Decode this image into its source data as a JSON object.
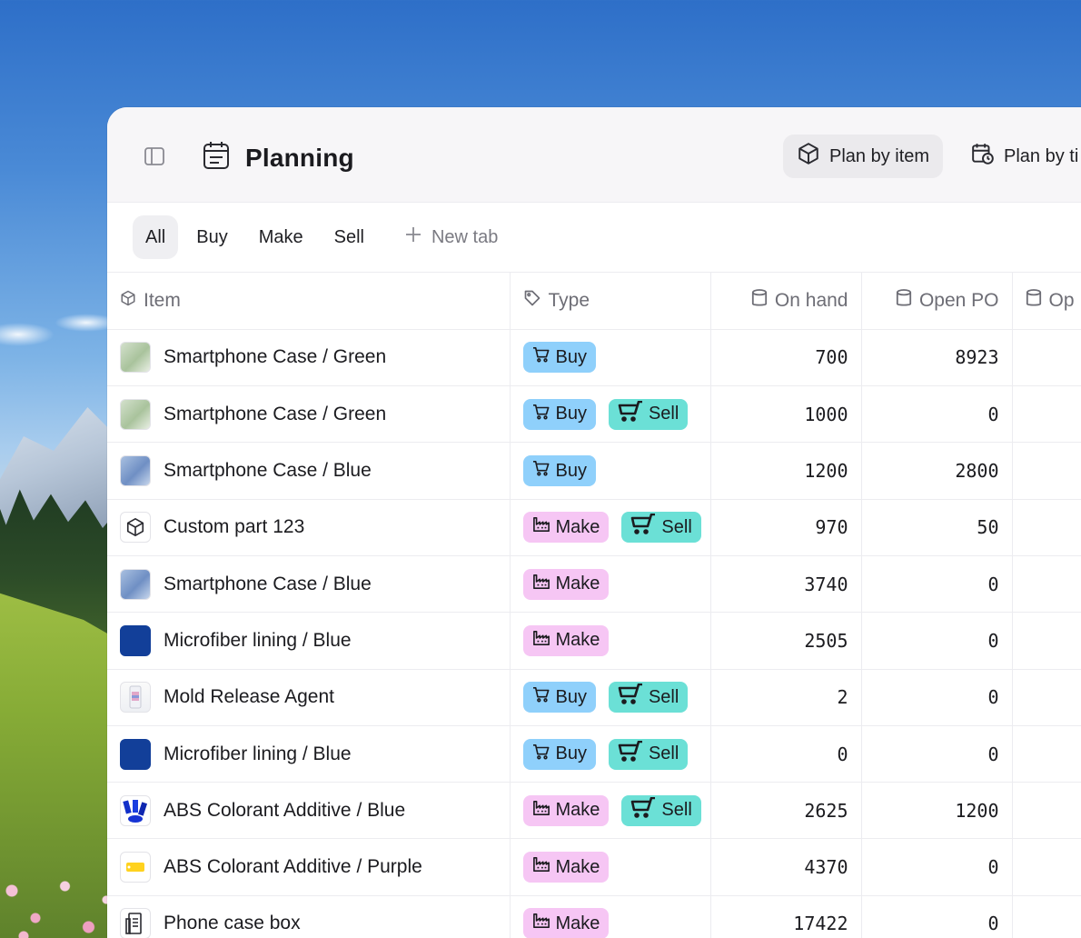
{
  "header": {
    "title": "Planning",
    "views": [
      {
        "label": "Plan by item",
        "icon": "cube-icon"
      },
      {
        "label": "Plan by ti",
        "icon": "calendar-clock-icon"
      }
    ]
  },
  "tabs": {
    "items": [
      "All",
      "Buy",
      "Make",
      "Sell"
    ],
    "new_tab_label": "New tab"
  },
  "columns": {
    "item": "Item",
    "type": "Type",
    "on_hand": "On hand",
    "open_po": "Open PO",
    "next": "Op"
  },
  "badges": {
    "buy": "Buy",
    "make": "Make",
    "sell": "Sell"
  },
  "rows": [
    {
      "name": "Smartphone Case / Green",
      "thumb": "green",
      "types": [
        "buy"
      ],
      "on_hand": "700",
      "open_po": "8923"
    },
    {
      "name": "Smartphone Case / Green",
      "thumb": "green",
      "types": [
        "buy",
        "sell"
      ],
      "on_hand": "1000",
      "open_po": "0"
    },
    {
      "name": "Smartphone Case / Blue",
      "thumb": "blue",
      "types": [
        "buy"
      ],
      "on_hand": "1200",
      "open_po": "2800"
    },
    {
      "name": "Custom part 123",
      "thumb": "cube",
      "types": [
        "make",
        "sell"
      ],
      "on_hand": "970",
      "open_po": "50"
    },
    {
      "name": "Smartphone Case / Blue",
      "thumb": "blue",
      "types": [
        "make"
      ],
      "on_hand": "3740",
      "open_po": "0"
    },
    {
      "name": "Microfiber lining / Blue",
      "thumb": "navy",
      "types": [
        "make"
      ],
      "on_hand": "2505",
      "open_po": "0"
    },
    {
      "name": "Mold Release Agent",
      "thumb": "mold",
      "types": [
        "buy",
        "sell"
      ],
      "on_hand": "2",
      "open_po": "0"
    },
    {
      "name": "Microfiber lining / Blue",
      "thumb": "navy",
      "types": [
        "buy",
        "sell"
      ],
      "on_hand": "0",
      "open_po": "0"
    },
    {
      "name": "ABS Colorant Additive / Blue",
      "thumb": "abs-blue",
      "types": [
        "make",
        "sell"
      ],
      "on_hand": "2625",
      "open_po": "1200"
    },
    {
      "name": "ABS Colorant Additive / Purple",
      "thumb": "purple",
      "types": [
        "make"
      ],
      "on_hand": "4370",
      "open_po": "0"
    },
    {
      "name": "Phone case box",
      "thumb": "box",
      "types": [
        "make"
      ],
      "on_hand": "17422",
      "open_po": "0"
    }
  ],
  "colors": {
    "buy": "#8fd0fb",
    "make": "#f6c6f4",
    "sell": "#6be0d6"
  }
}
